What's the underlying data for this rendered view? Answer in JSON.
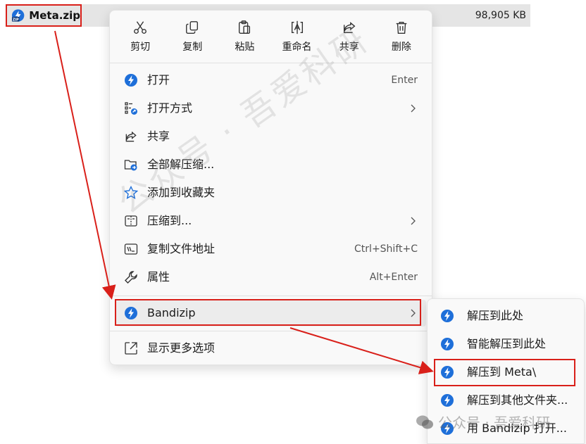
{
  "file": {
    "name": "Meta.zip",
    "size": "98,905 KB",
    "icon_badge": "ZIP"
  },
  "quick_actions": [
    {
      "label": "剪切",
      "icon": "scissors-icon"
    },
    {
      "label": "复制",
      "icon": "copy-icon"
    },
    {
      "label": "粘贴",
      "icon": "paste-icon"
    },
    {
      "label": "重命名",
      "icon": "rename-icon"
    },
    {
      "label": "共享",
      "icon": "share-icon"
    },
    {
      "label": "删除",
      "icon": "trash-icon"
    }
  ],
  "menu_items": [
    {
      "label": "打开",
      "shortcut": "Enter",
      "icon": "bandizip-icon"
    },
    {
      "label": "打开方式",
      "shortcut": "",
      "icon": "open-with-icon",
      "submenu": true
    },
    {
      "label": "共享",
      "shortcut": "",
      "icon": "share-icon"
    },
    {
      "label": "全部解压缩...",
      "shortcut": "",
      "icon": "extract-all-icon"
    },
    {
      "label": "添加到收藏夹",
      "shortcut": "",
      "icon": "star-icon"
    },
    {
      "label": "压缩到...",
      "shortcut": "",
      "icon": "compress-icon",
      "submenu": true
    },
    {
      "label": "复制文件地址",
      "shortcut": "Ctrl+Shift+C",
      "icon": "copy-path-icon"
    },
    {
      "label": "属性",
      "shortcut": "Alt+Enter",
      "icon": "wrench-icon"
    }
  ],
  "bandizip_item": {
    "label": "Bandizip",
    "icon": "bandizip-icon"
  },
  "more_options": {
    "label": "显示更多选项",
    "icon": "more-options-icon"
  },
  "submenu_items": [
    {
      "label": "解压到此处"
    },
    {
      "label": "智能解压到此处"
    },
    {
      "label": "解压到 Meta\\"
    },
    {
      "label": "解压到其他文件夹..."
    },
    {
      "label": "用 Bandizip 打开..."
    }
  ],
  "watermark": {
    "main": "公众号 · 吾爱科研",
    "corner": "公众号 · 吾爱科研"
  },
  "colors": {
    "annotation_red": "#d9201a",
    "bandizip_blue": "#1e6fd9",
    "menu_bg": "#f9f9f9"
  }
}
